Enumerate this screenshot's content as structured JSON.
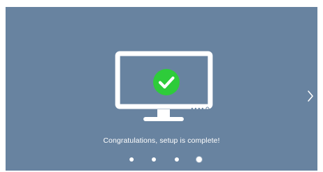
{
  "setup": {
    "message": "Congratulations, setup is complete!",
    "pages_total": 4,
    "active_page_index": 3
  },
  "icons": {
    "tv": "tv-icon",
    "success": "checkmark-circle-icon",
    "next": "chevron-right-icon"
  },
  "colors": {
    "background": "#6883a0",
    "success_green": "#2ecc3a",
    "foreground": "#ffffff"
  }
}
